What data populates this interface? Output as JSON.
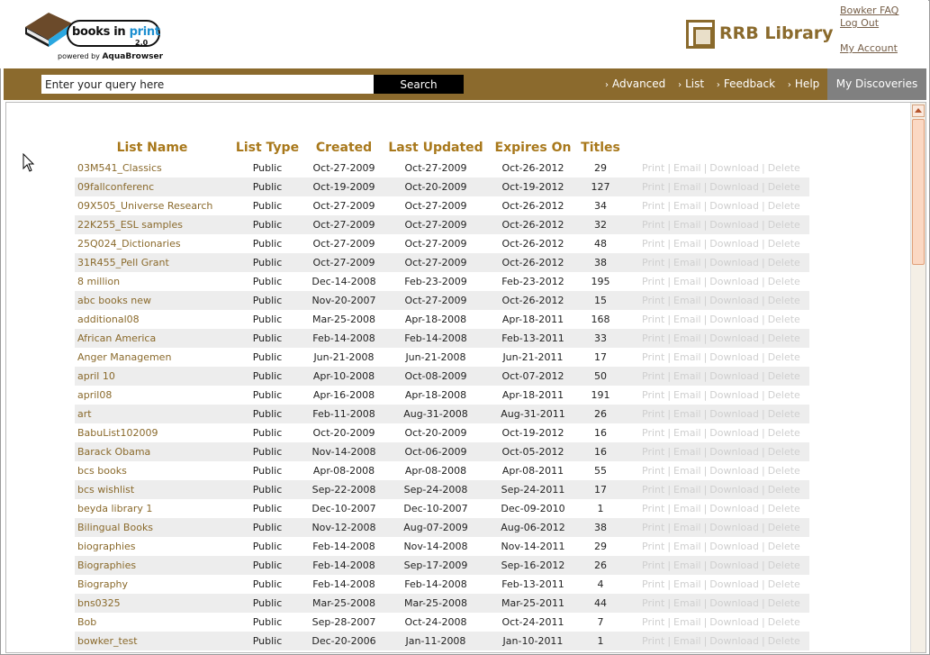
{
  "header": {
    "brand": {
      "prefix": "books in ",
      "highlight": "print",
      "version": "2.0",
      "powered_prefix": "powered by ",
      "powered_by": "AquaBrowser"
    },
    "library_logo": "RRB Library",
    "links": {
      "faq": "Bowker FAQ",
      "logout": "Log Out",
      "account": "My Account"
    }
  },
  "nav": {
    "search": {
      "placeholder": "Enter your query here",
      "button": "Search"
    },
    "links": [
      "Advanced",
      "List",
      "Feedback",
      "Help"
    ],
    "my_discoveries": "My Discoveries"
  },
  "table": {
    "headers": [
      "List Name",
      "List Type",
      "Created",
      "Last Updated",
      "Expires On",
      "Titles"
    ],
    "actions": [
      "Print",
      "Email",
      "Download",
      "Delete"
    ],
    "rows": [
      {
        "name": "03M541_Classics",
        "type": "Public",
        "created": "Oct-27-2009",
        "updated": "Oct-27-2009",
        "expires": "Oct-26-2012",
        "titles": "29"
      },
      {
        "name": "09fallconferenc",
        "type": "Public",
        "created": "Oct-19-2009",
        "updated": "Oct-20-2009",
        "expires": "Oct-19-2012",
        "titles": "127"
      },
      {
        "name": "09X505_Universe Research",
        "type": "Public",
        "created": "Oct-27-2009",
        "updated": "Oct-27-2009",
        "expires": "Oct-26-2012",
        "titles": "34"
      },
      {
        "name": "22K255_ESL samples",
        "type": "Public",
        "created": "Oct-27-2009",
        "updated": "Oct-27-2009",
        "expires": "Oct-26-2012",
        "titles": "32"
      },
      {
        "name": "25Q024_Dictionaries",
        "type": "Public",
        "created": "Oct-27-2009",
        "updated": "Oct-27-2009",
        "expires": "Oct-26-2012",
        "titles": "48"
      },
      {
        "name": "31R455_Pell Grant",
        "type": "Public",
        "created": "Oct-27-2009",
        "updated": "Oct-27-2009",
        "expires": "Oct-26-2012",
        "titles": "38"
      },
      {
        "name": "8 million",
        "type": "Public",
        "created": "Dec-14-2008",
        "updated": "Feb-23-2009",
        "expires": "Feb-23-2012",
        "titles": "195"
      },
      {
        "name": "abc books new",
        "type": "Public",
        "created": "Nov-20-2007",
        "updated": "Oct-27-2009",
        "expires": "Oct-26-2012",
        "titles": "15"
      },
      {
        "name": "additional08",
        "type": "Public",
        "created": "Mar-25-2008",
        "updated": "Apr-18-2008",
        "expires": "Apr-18-2011",
        "titles": "168"
      },
      {
        "name": "African America",
        "type": "Public",
        "created": "Feb-14-2008",
        "updated": "Feb-14-2008",
        "expires": "Feb-13-2011",
        "titles": "33"
      },
      {
        "name": "Anger Managemen",
        "type": "Public",
        "created": "Jun-21-2008",
        "updated": "Jun-21-2008",
        "expires": "Jun-21-2011",
        "titles": "17"
      },
      {
        "name": "april 10",
        "type": "Public",
        "created": "Apr-10-2008",
        "updated": "Oct-08-2009",
        "expires": "Oct-07-2012",
        "titles": "50"
      },
      {
        "name": "april08",
        "type": "Public",
        "created": "Apr-16-2008",
        "updated": "Apr-18-2008",
        "expires": "Apr-18-2011",
        "titles": "191"
      },
      {
        "name": "art",
        "type": "Public",
        "created": "Feb-11-2008",
        "updated": "Aug-31-2008",
        "expires": "Aug-31-2011",
        "titles": "26"
      },
      {
        "name": "BabuList102009",
        "type": "Public",
        "created": "Oct-20-2009",
        "updated": "Oct-20-2009",
        "expires": "Oct-19-2012",
        "titles": "16"
      },
      {
        "name": "Barack Obama",
        "type": "Public",
        "created": "Nov-14-2008",
        "updated": "Oct-06-2009",
        "expires": "Oct-05-2012",
        "titles": "16"
      },
      {
        "name": "bcs books",
        "type": "Public",
        "created": "Apr-08-2008",
        "updated": "Apr-08-2008",
        "expires": "Apr-08-2011",
        "titles": "55"
      },
      {
        "name": "bcs wishlist",
        "type": "Public",
        "created": "Sep-22-2008",
        "updated": "Sep-24-2008",
        "expires": "Sep-24-2011",
        "titles": "17"
      },
      {
        "name": "beyda library 1",
        "type": "Public",
        "created": "Dec-10-2007",
        "updated": "Dec-10-2007",
        "expires": "Dec-09-2010",
        "titles": "1"
      },
      {
        "name": "Bilingual Books",
        "type": "Public",
        "created": "Nov-12-2008",
        "updated": "Aug-07-2009",
        "expires": "Aug-06-2012",
        "titles": "38"
      },
      {
        "name": "biographies",
        "type": "Public",
        "created": "Feb-14-2008",
        "updated": "Nov-14-2008",
        "expires": "Nov-14-2011",
        "titles": "29"
      },
      {
        "name": "Biographies",
        "type": "Public",
        "created": "Feb-14-2008",
        "updated": "Sep-17-2009",
        "expires": "Sep-16-2012",
        "titles": "26"
      },
      {
        "name": "Biography",
        "type": "Public",
        "created": "Feb-14-2008",
        "updated": "Feb-14-2008",
        "expires": "Feb-13-2011",
        "titles": "4"
      },
      {
        "name": "bns0325",
        "type": "Public",
        "created": "Mar-25-2008",
        "updated": "Mar-25-2008",
        "expires": "Mar-25-2011",
        "titles": "44"
      },
      {
        "name": "Bob",
        "type": "Public",
        "created": "Sep-28-2007",
        "updated": "Oct-24-2008",
        "expires": "Oct-24-2011",
        "titles": "7"
      },
      {
        "name": "bowker_test",
        "type": "Public",
        "created": "Dec-20-2006",
        "updated": "Jan-11-2008",
        "expires": "Jan-10-2011",
        "titles": "1"
      }
    ]
  }
}
